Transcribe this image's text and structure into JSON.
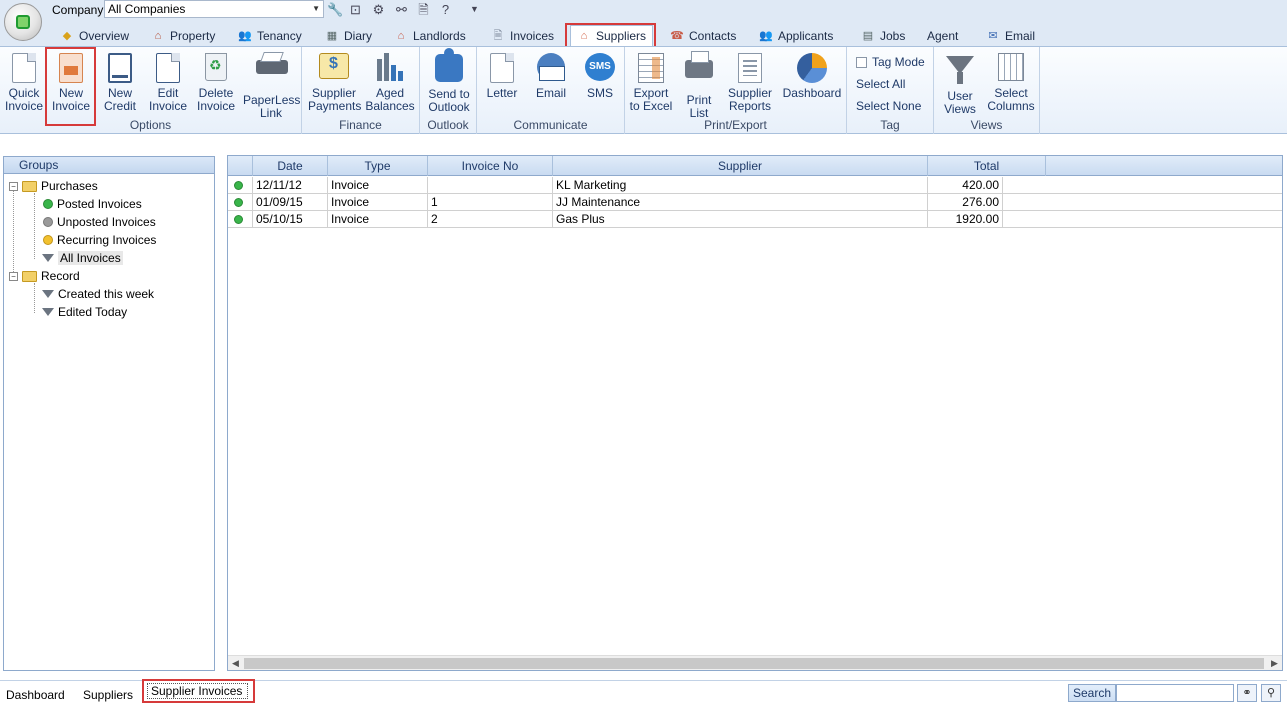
{
  "header": {
    "company_label": "Company",
    "company_value": "All Companies"
  },
  "tabs": [
    {
      "label": "Overview",
      "icon": "overview-icon"
    },
    {
      "label": "Property",
      "icon": "house-icon"
    },
    {
      "label": "Tenancy",
      "icon": "people-icon"
    },
    {
      "label": "Diary",
      "icon": "calendar-icon"
    },
    {
      "label": "Landlords",
      "icon": "landlord-icon"
    },
    {
      "label": "Invoices",
      "icon": "invoice-icon"
    },
    {
      "label": "Suppliers",
      "icon": "supplier-icon",
      "active": true
    },
    {
      "label": "Contacts",
      "icon": "contacts-icon"
    },
    {
      "label": "Applicants",
      "icon": "applicants-icon"
    },
    {
      "label": "Jobs",
      "icon": "jobs-icon"
    },
    {
      "label": "Agent",
      "icon": ""
    },
    {
      "label": "Email",
      "icon": "email-icon"
    }
  ],
  "ribbon": {
    "options": {
      "label": "Options",
      "quick_invoice": [
        "Quick",
        "Invoice"
      ],
      "new_invoice": [
        "New",
        "Invoice"
      ],
      "new_credit": [
        "New",
        "Credit"
      ],
      "edit_invoice": [
        "Edit",
        "Invoice"
      ],
      "delete_invoice": [
        "Delete",
        "Invoice"
      ],
      "paperless_link": [
        "PaperLess",
        "Link"
      ]
    },
    "finance": {
      "label": "Finance",
      "supplier_payments": [
        "Supplier",
        "Payments"
      ],
      "aged_balances": [
        "Aged",
        "Balances"
      ]
    },
    "outlook": {
      "label": "Outlook",
      "send_to_outlook": [
        "Send to",
        "Outlook"
      ]
    },
    "communicate": {
      "label": "Communicate",
      "letter": "Letter",
      "email": "Email",
      "sms": "SMS",
      "sms_icon_text": "SMS"
    },
    "print_export": {
      "label": "Print/Export",
      "export_excel": [
        "Export",
        "to Excel"
      ],
      "print_list": [
        "Print",
        "List"
      ],
      "supplier_reports": [
        "Supplier",
        "Reports"
      ],
      "dashboard": "Dashboard"
    },
    "tag": {
      "label": "Tag",
      "tag_mode": "Tag Mode",
      "select_all": "Select All",
      "select_none": "Select None"
    },
    "views": {
      "label": "Views",
      "user_views": [
        "User",
        "Views"
      ],
      "select_columns": [
        "Select",
        "Columns"
      ]
    }
  },
  "groups": {
    "title": "Groups",
    "purchases": "Purchases",
    "posted": "Posted Invoices",
    "unposted": "Unposted Invoices",
    "recurring": "Recurring Invoices",
    "all": "All Invoices",
    "record": "Record",
    "created_week": "Created this week",
    "edited_today": "Edited Today"
  },
  "grid": {
    "columns": [
      "Date",
      "Type",
      "Invoice No",
      "Supplier",
      "Total"
    ],
    "rows": [
      {
        "date": "12/11/12",
        "type": "Invoice",
        "invoice_no": "",
        "supplier": "KL Marketing",
        "total": "420.00"
      },
      {
        "date": "01/09/15",
        "type": "Invoice",
        "invoice_no": "1",
        "supplier": "JJ Maintenance",
        "total": "276.00"
      },
      {
        "date": "05/10/15",
        "type": "Invoice",
        "invoice_no": "2",
        "supplier": "Gas Plus",
        "total": "1920.00"
      }
    ]
  },
  "footer": {
    "tabs": [
      "Dashboard",
      "Suppliers",
      "Supplier Invoices"
    ],
    "search_label": "Search"
  },
  "colors": {
    "accent_highlight": "#d63a3a",
    "status_green": "#39b54a",
    "ribbon_text": "#1f3a68"
  }
}
